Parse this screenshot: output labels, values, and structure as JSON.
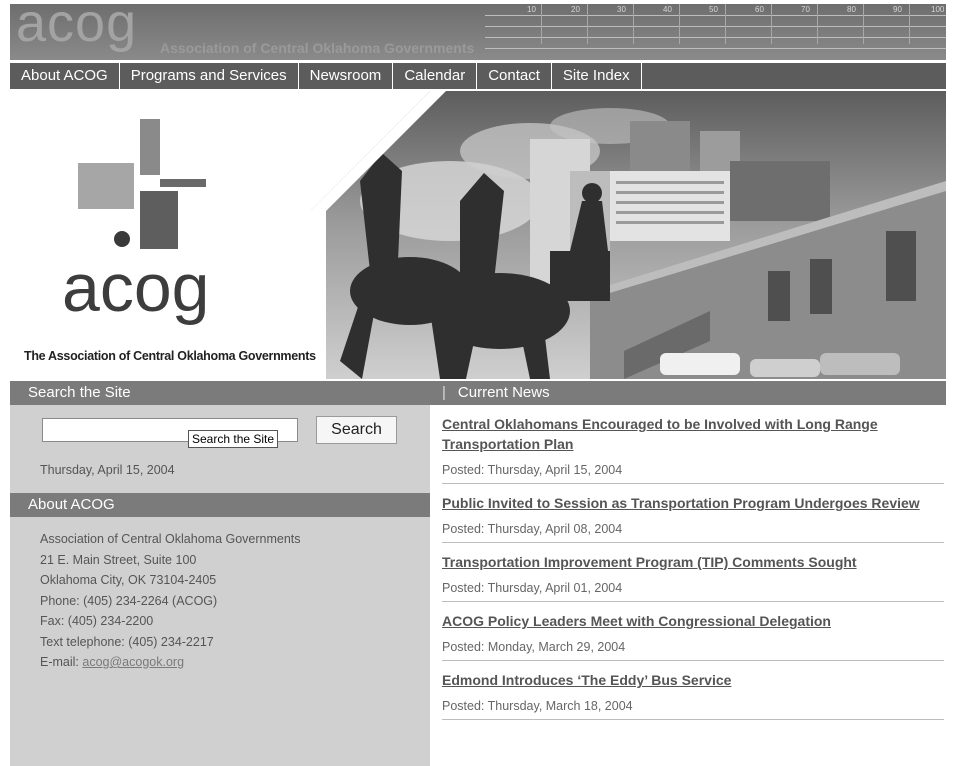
{
  "header": {
    "logo_text": "acog",
    "org_name": "Association of Central Oklahoma Governments",
    "ruler_marks": [
      "10",
      "20",
      "30",
      "40",
      "50",
      "60",
      "70",
      "80",
      "90",
      "100"
    ]
  },
  "nav": {
    "items": [
      "About ACOG",
      "Programs and Services",
      "Newsroom",
      "Calendar",
      "Contact",
      "Site Index"
    ]
  },
  "hero": {
    "logo_word": "acog",
    "tagline": "The Association of Central Oklahoma Governments"
  },
  "search": {
    "heading": "Search the Site",
    "input_value": "",
    "tooltip": "Search the Site",
    "button_label": "Search",
    "date": "Thursday, April 15, 2004"
  },
  "about": {
    "heading": "About ACOG",
    "lines": [
      "Association of Central Oklahoma Governments",
      "21 E. Main Street, Suite 100",
      "Oklahoma City, OK 73104-2405",
      "Phone: (405) 234-2264 (ACOG)",
      "Fax: (405) 234-2200",
      "Text telephone: (405) 234-2217"
    ],
    "email_label": "E-mail:",
    "email": "acog@acogok.org"
  },
  "news": {
    "heading": "Current News",
    "items": [
      {
        "title": "Central Oklahomans Encouraged to be Involved with Long Range Transportation Plan",
        "posted": "Posted: Thursday, April 15, 2004"
      },
      {
        "title": "Public Invited to Session as Transportation Program Undergoes Review",
        "posted": "Posted: Thursday, April 08, 2004"
      },
      {
        "title": "Transportation Improvement Program (TIP) Comments Sought",
        "posted": "Posted: Thursday, April 01, 2004"
      },
      {
        "title": "ACOG Policy Leaders Meet with Congressional Delegation",
        "posted": "Posted: Monday, March 29, 2004"
      },
      {
        "title": "Edmond Introduces ‘The Eddy’ Bus Service",
        "posted": "Posted: Thursday, March 18, 2004"
      }
    ]
  }
}
